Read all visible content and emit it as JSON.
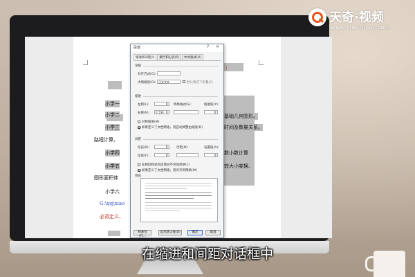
{
  "brand": {
    "name": "天奇·视频",
    "url": "www.tianqijun.com"
  },
  "subtitle": "在缩进和间距对话框中",
  "document": {
    "lines": [
      {
        "text": "小学一",
        "style": "hl"
      },
      {
        "text": "小学二",
        "style": "hl"
      },
      {
        "text": "小学三",
        "style": "hl"
      },
      {
        "text": "路程计算。",
        "style": "plain"
      },
      {
        "text": "小学四",
        "style": "hl"
      },
      {
        "text": "小学五",
        "style": "hl"
      },
      {
        "text": "图形面积体",
        "style": "plain"
      },
      {
        "text": "小学六",
        "style": "plain"
      },
      {
        "text": "G:\\qq\\xiao",
        "style": "blue"
      },
      {
        "text": "必背定义、",
        "style": "red"
      }
    ],
    "right_fragments": [
      {
        "text": "）",
        "style": "red"
      },
      {
        "text": "基础几何图形。",
        "style": "hl"
      },
      {
        "text": "时间及数量关系。",
        "style": "hl"
      },
      {
        "text": "数小数计算",
        "style": "hl"
      },
      {
        "text": "较大小变换、",
        "style": "hl"
      }
    ]
  },
  "dialog": {
    "title": "段落",
    "help": "?",
    "close": "×",
    "tabs": [
      "缩进和间距(I)",
      "换行和分页(P)",
      "中文版式(H)"
    ],
    "section_general": "常规",
    "alignment_label": "对齐方式(G):",
    "alignment_value": "",
    "outline_label": "大纲级别(O):",
    "outline_value": "正文文本",
    "collapse_label": "默认情况下折叠(E)",
    "section_indent": "缩进",
    "left_label": "左侧(L):",
    "left_value": "",
    "right_label": "右侧(R):",
    "right_value": "0 字符",
    "special_label": "特殊格式(S):",
    "special_value": "",
    "indent_value_label": "缩进值(Y):",
    "mirror_label": "对称缩进(M)",
    "auto_right_label": "如果定义了文档网格，则自动调整右缩进(D)",
    "section_spacing": "间距",
    "before_label": "段前(B):",
    "after_label": "段后(F):",
    "line_spacing_label": "行距(N):",
    "setting_label": "设置值(A):",
    "no_space_label": "在相同样式的段落间不添加空格(C)",
    "snap_grid_label": "如果定义了文档网格，则对齐到网格(W)",
    "section_preview": "预览",
    "buttons": {
      "tabs": "制表位(T)...",
      "default": "设为默认值(D)",
      "ok": "确定",
      "cancel": "取消"
    }
  }
}
